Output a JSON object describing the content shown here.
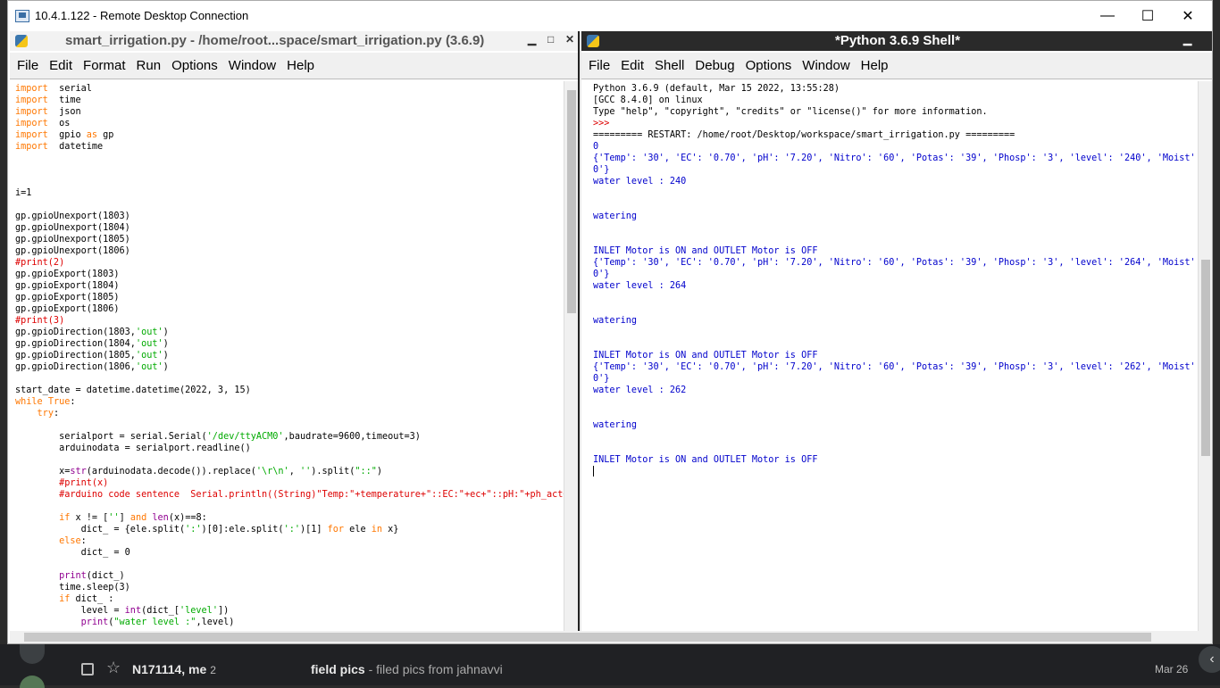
{
  "rdp": {
    "title": "10.4.1.122 - Remote Desktop Connection",
    "minimize": "—",
    "maximize": "☐",
    "close": "✕"
  },
  "editor": {
    "title": "smart_irrigation.py - /home/root...space/smart_irrigation.py (3.6.9)",
    "controls": [
      "▁",
      "□",
      "✕"
    ],
    "menu": [
      "File",
      "Edit",
      "Format",
      "Run",
      "Options",
      "Window",
      "Help"
    ],
    "code": [
      [
        [
          "kw",
          "import"
        ],
        [
          "",
          "  serial"
        ]
      ],
      [
        [
          "kw",
          "import"
        ],
        [
          "",
          "  time"
        ]
      ],
      [
        [
          "kw",
          "import"
        ],
        [
          "",
          "  json"
        ]
      ],
      [
        [
          "kw",
          "import"
        ],
        [
          "",
          "  os"
        ]
      ],
      [
        [
          "kw",
          "import"
        ],
        [
          "",
          "  gpio "
        ],
        [
          "kw",
          "as"
        ],
        [
          "",
          " gp"
        ]
      ],
      [
        [
          "kw",
          "import"
        ],
        [
          "",
          "  datetime"
        ]
      ],
      [],
      [],
      [],
      [
        [
          "",
          "i=1"
        ]
      ],
      [],
      [
        [
          "",
          "gp.gpioUnexport(1803)"
        ]
      ],
      [
        [
          "",
          "gp.gpioUnexport(1804)"
        ]
      ],
      [
        [
          "",
          "gp.gpioUnexport(1805)"
        ]
      ],
      [
        [
          "",
          "gp.gpioUnexport(1806)"
        ]
      ],
      [
        [
          "cm",
          "#print(2)"
        ]
      ],
      [
        [
          "",
          "gp.gpioExport(1803)"
        ]
      ],
      [
        [
          "",
          "gp.gpioExport(1804)"
        ]
      ],
      [
        [
          "",
          "gp.gpioExport(1805)"
        ]
      ],
      [
        [
          "",
          "gp.gpioExport(1806)"
        ]
      ],
      [
        [
          "cm",
          "#print(3)"
        ]
      ],
      [
        [
          "",
          "gp.gpioDirection(1803,"
        ],
        [
          "st",
          "'out'"
        ],
        [
          "",
          ")"
        ]
      ],
      [
        [
          "",
          "gp.gpioDirection(1804,"
        ],
        [
          "st",
          "'out'"
        ],
        [
          "",
          ")"
        ]
      ],
      [
        [
          "",
          "gp.gpioDirection(1805,"
        ],
        [
          "st",
          "'out'"
        ],
        [
          "",
          ")"
        ]
      ],
      [
        [
          "",
          "gp.gpioDirection(1806,"
        ],
        [
          "st",
          "'out'"
        ],
        [
          "",
          ")"
        ]
      ],
      [],
      [
        [
          "",
          "start_date = datetime.datetime(2022, 3, 15)"
        ]
      ],
      [
        [
          "kw",
          "while"
        ],
        [
          "",
          " "
        ],
        [
          "kw",
          "True"
        ],
        [
          "",
          ":"
        ]
      ],
      [
        [
          "",
          "    "
        ],
        [
          "kw",
          "try"
        ],
        [
          "",
          ":"
        ]
      ],
      [],
      [
        [
          "",
          "        serialport = serial.Serial("
        ],
        [
          "st",
          "'/dev/ttyACM0'"
        ],
        [
          "",
          ",baudrate=9600,timeout=3)"
        ]
      ],
      [
        [
          "",
          "        arduinodata = serialport.readline()"
        ]
      ],
      [],
      [
        [
          "",
          "        x="
        ],
        [
          "bi",
          "str"
        ],
        [
          "",
          "(arduinodata.decode()).replace("
        ],
        [
          "st",
          "'\\r\\n'"
        ],
        [
          "",
          ", "
        ],
        [
          "st",
          "''"
        ],
        [
          "",
          ").split("
        ],
        [
          "st",
          "\"::\""
        ],
        [
          "",
          ")"
        ]
      ],
      [
        [
          "cm",
          "        #print(x)"
        ]
      ],
      [
        [
          "cm",
          "        #arduino code sentence  Serial.println((String)\"Temp:\"+temperature+\"::EC:\"+ec+\"::pH:\"+ph_act+"
        ]
      ],
      [],
      [
        [
          "",
          "        "
        ],
        [
          "kw",
          "if"
        ],
        [
          "",
          " x != ["
        ],
        [
          "st",
          "''"
        ],
        [
          "",
          "] "
        ],
        [
          "kw",
          "and"
        ],
        [
          "",
          " "
        ],
        [
          "bi",
          "len"
        ],
        [
          "",
          "(x)==8:"
        ]
      ],
      [
        [
          "",
          "            dict_ = {ele.split("
        ],
        [
          "st",
          "':'"
        ],
        [
          "",
          ")[0]:ele.split("
        ],
        [
          "st",
          "':'"
        ],
        [
          "",
          ")[1] "
        ],
        [
          "kw",
          "for"
        ],
        [
          "",
          " ele "
        ],
        [
          "kw",
          "in"
        ],
        [
          "",
          " x}"
        ]
      ],
      [
        [
          "",
          "        "
        ],
        [
          "kw",
          "else"
        ],
        [
          "",
          ":"
        ]
      ],
      [
        [
          "",
          "            dict_ = 0"
        ]
      ],
      [],
      [
        [
          "",
          "        "
        ],
        [
          "bi",
          "print"
        ],
        [
          "",
          "(dict_)"
        ]
      ],
      [
        [
          "",
          "        time.sleep(3)"
        ]
      ],
      [
        [
          "",
          "        "
        ],
        [
          "kw",
          "if"
        ],
        [
          "",
          " dict_ :"
        ]
      ],
      [
        [
          "",
          "            level = "
        ],
        [
          "bi",
          "int"
        ],
        [
          "",
          "(dict_["
        ],
        [
          "st",
          "'level'"
        ],
        [
          "",
          "])"
        ]
      ],
      [
        [
          "",
          "            "
        ],
        [
          "bi",
          "print"
        ],
        [
          "",
          "("
        ],
        [
          "st",
          "\"water level :\""
        ],
        [
          "",
          ",level)"
        ]
      ]
    ]
  },
  "shell": {
    "title": "*Python 3.6.9 Shell*",
    "controls": [
      "▁"
    ],
    "menu": [
      "File",
      "Edit",
      "Shell",
      "Debug",
      "Options",
      "Window",
      "Help"
    ],
    "lines": [
      [
        "hdr",
        "Python 3.6.9 (default, Mar 15 2022, 13:55:28)"
      ],
      [
        "hdr",
        "[GCC 8.4.0] on linux"
      ],
      [
        "hdr",
        "Type \"help\", \"copyright\", \"credits\" or \"license()\" for more information."
      ],
      [
        "cm",
        ">>>"
      ],
      [
        "hdr",
        "========= RESTART: /home/root/Desktop/workspace/smart_irrigation.py ========="
      ],
      [
        "blue",
        "0"
      ],
      [
        "blue",
        "{'Temp': '30', 'EC': '0.70', 'pH': '7.20', 'Nitro': '60', 'Potas': '39', 'Phosp': '3', 'level': '240', 'Moist': '1"
      ],
      [
        "blue",
        "0'}"
      ],
      [
        "blue",
        "water level : 240"
      ],
      [
        "blue",
        ""
      ],
      [
        "blue",
        ""
      ],
      [
        "blue",
        "watering"
      ],
      [
        "blue",
        ""
      ],
      [
        "blue",
        ""
      ],
      [
        "blue",
        "INLET Motor is ON and OUTLET Motor is OFF"
      ],
      [
        "blue",
        "{'Temp': '30', 'EC': '0.70', 'pH': '7.20', 'Nitro': '60', 'Potas': '39', 'Phosp': '3', 'level': '264', 'Moist': '1"
      ],
      [
        "blue",
        "0'}"
      ],
      [
        "blue",
        "water level : 264"
      ],
      [
        "blue",
        ""
      ],
      [
        "blue",
        ""
      ],
      [
        "blue",
        "watering"
      ],
      [
        "blue",
        ""
      ],
      [
        "blue",
        ""
      ],
      [
        "blue",
        "INLET Motor is ON and OUTLET Motor is OFF"
      ],
      [
        "blue",
        "{'Temp': '30', 'EC': '0.70', 'pH': '7.20', 'Nitro': '60', 'Potas': '39', 'Phosp': '3', 'level': '262', 'Moist': '1"
      ],
      [
        "blue",
        "0'}"
      ],
      [
        "blue",
        "water level : 262"
      ],
      [
        "blue",
        ""
      ],
      [
        "blue",
        ""
      ],
      [
        "blue",
        "watering"
      ],
      [
        "blue",
        ""
      ],
      [
        "blue",
        ""
      ],
      [
        "blue",
        "INLET Motor is ON and OUTLET Motor is OFF"
      ]
    ]
  },
  "gmail": {
    "sender": "N171114, me",
    "count": "2",
    "subject": "field pics",
    "snippet": " - filed pics from jahnavvi",
    "date": "Mar 26"
  }
}
